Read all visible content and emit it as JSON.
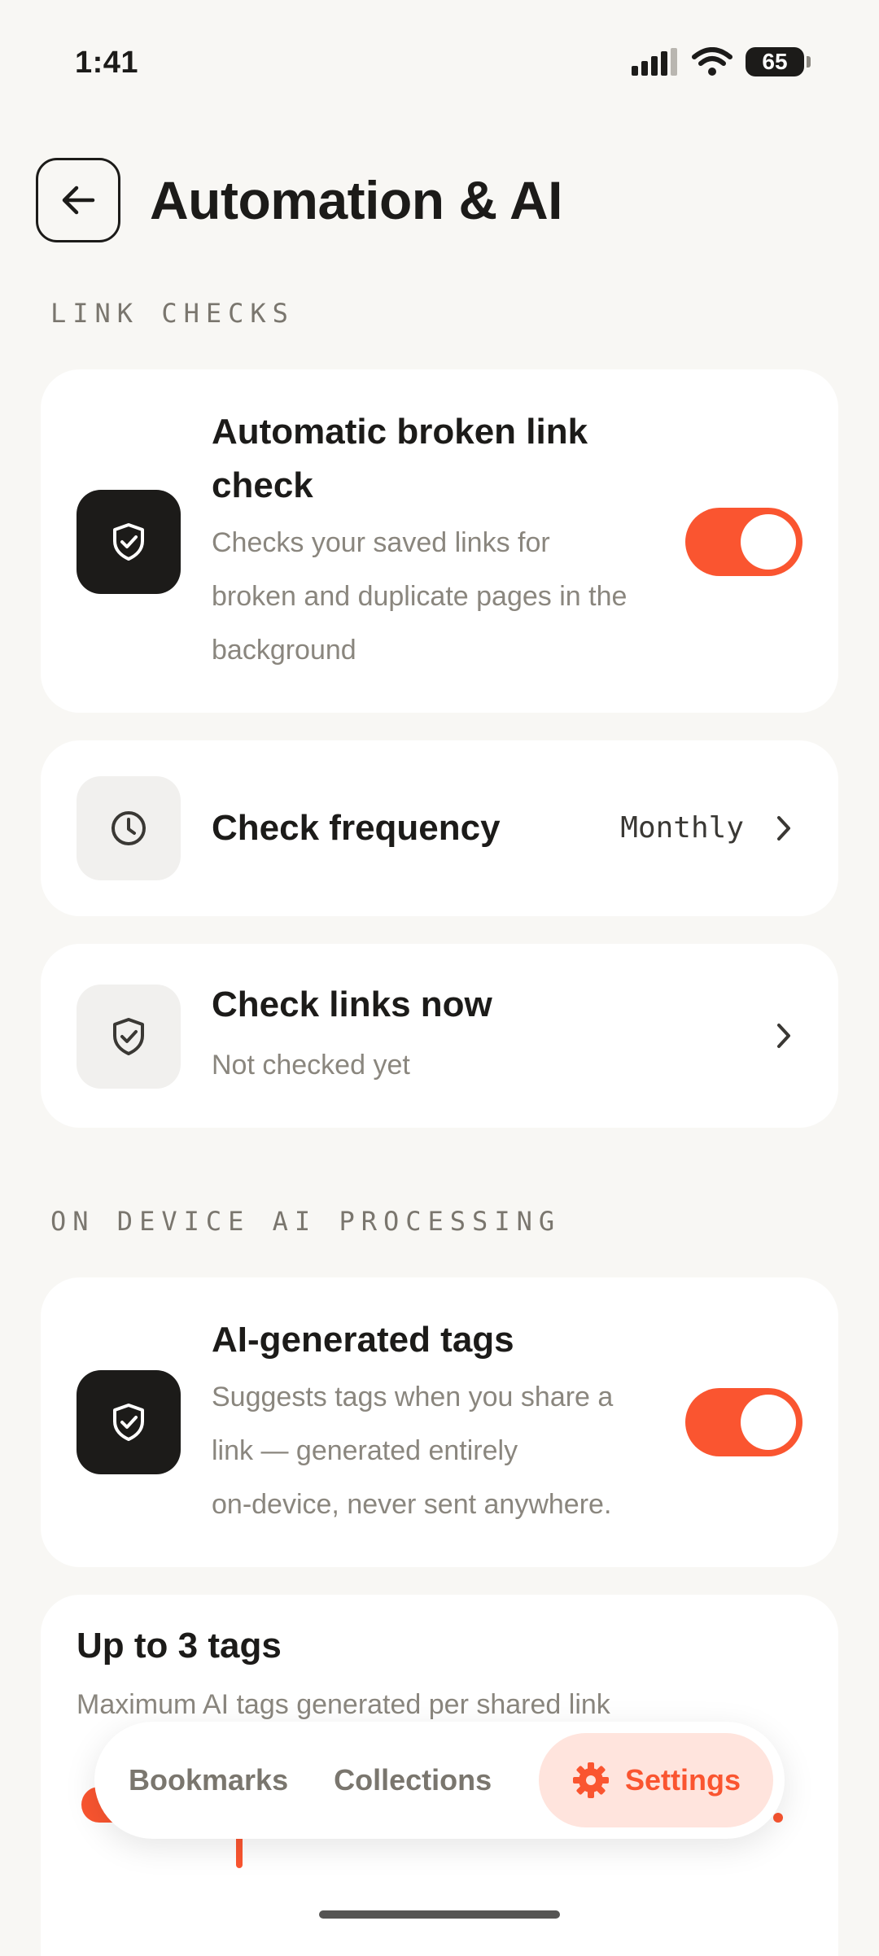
{
  "status_bar": {
    "time": "1:41",
    "battery": "65"
  },
  "header": {
    "title": "Automation & AI"
  },
  "sections": {
    "link_checks": "LINK CHECKS",
    "ai": "ON DEVICE AI PROCESSING"
  },
  "cards": {
    "broken_link": {
      "title_line1": "Automatic broken link",
      "title_line2": "check",
      "desc_line1": "Checks your saved links for",
      "desc_line2": "broken and duplicate pages in the",
      "desc_line3": "background",
      "enabled": true
    },
    "frequency": {
      "title": "Check frequency",
      "value": "Monthly"
    },
    "check_now": {
      "title": "Check links now",
      "subtitle": "Not checked yet"
    },
    "ai_tags": {
      "title": "AI-generated tags",
      "desc_line1": "Suggests tags when you share a",
      "desc_line2": "link — generated entirely",
      "desc_line3": "on-device, never sent anywhere.",
      "enabled": true
    },
    "max_tags": {
      "title": "Up to 3 tags",
      "subtitle": "Maximum AI tags generated per shared link"
    }
  },
  "bottom_nav": {
    "items": [
      {
        "label": "Bookmarks"
      },
      {
        "label": "Collections"
      },
      {
        "label": "Settings",
        "active": true
      }
    ]
  },
  "colors": {
    "accent": "#FA5530",
    "background": "#F8F7F4",
    "card": "#FFFFFF",
    "dark_tile": "#1C1B19"
  }
}
